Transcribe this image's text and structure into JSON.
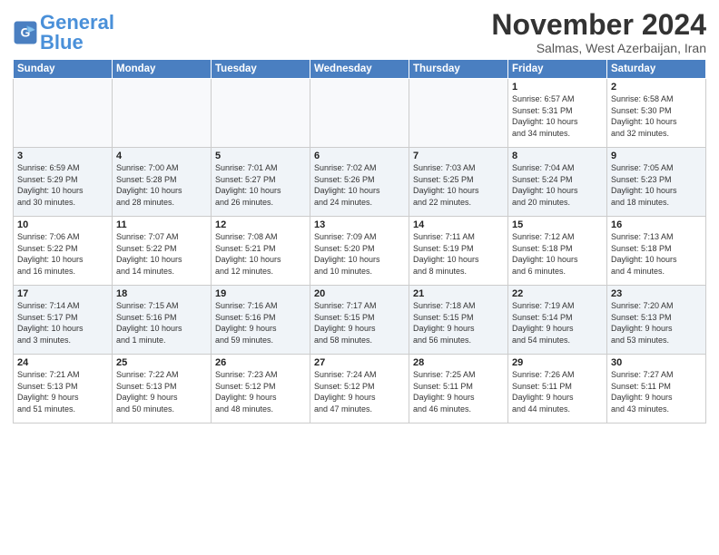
{
  "logo": {
    "text_general": "General",
    "text_blue": "Blue"
  },
  "title": "November 2024",
  "subtitle": "Salmas, West Azerbaijan, Iran",
  "weekdays": [
    "Sunday",
    "Monday",
    "Tuesday",
    "Wednesday",
    "Thursday",
    "Friday",
    "Saturday"
  ],
  "weeks": [
    [
      {
        "day": "",
        "info": ""
      },
      {
        "day": "",
        "info": ""
      },
      {
        "day": "",
        "info": ""
      },
      {
        "day": "",
        "info": ""
      },
      {
        "day": "",
        "info": ""
      },
      {
        "day": "1",
        "info": "Sunrise: 6:57 AM\nSunset: 5:31 PM\nDaylight: 10 hours\nand 34 minutes."
      },
      {
        "day": "2",
        "info": "Sunrise: 6:58 AM\nSunset: 5:30 PM\nDaylight: 10 hours\nand 32 minutes."
      }
    ],
    [
      {
        "day": "3",
        "info": "Sunrise: 6:59 AM\nSunset: 5:29 PM\nDaylight: 10 hours\nand 30 minutes."
      },
      {
        "day": "4",
        "info": "Sunrise: 7:00 AM\nSunset: 5:28 PM\nDaylight: 10 hours\nand 28 minutes."
      },
      {
        "day": "5",
        "info": "Sunrise: 7:01 AM\nSunset: 5:27 PM\nDaylight: 10 hours\nand 26 minutes."
      },
      {
        "day": "6",
        "info": "Sunrise: 7:02 AM\nSunset: 5:26 PM\nDaylight: 10 hours\nand 24 minutes."
      },
      {
        "day": "7",
        "info": "Sunrise: 7:03 AM\nSunset: 5:25 PM\nDaylight: 10 hours\nand 22 minutes."
      },
      {
        "day": "8",
        "info": "Sunrise: 7:04 AM\nSunset: 5:24 PM\nDaylight: 10 hours\nand 20 minutes."
      },
      {
        "day": "9",
        "info": "Sunrise: 7:05 AM\nSunset: 5:23 PM\nDaylight: 10 hours\nand 18 minutes."
      }
    ],
    [
      {
        "day": "10",
        "info": "Sunrise: 7:06 AM\nSunset: 5:22 PM\nDaylight: 10 hours\nand 16 minutes."
      },
      {
        "day": "11",
        "info": "Sunrise: 7:07 AM\nSunset: 5:22 PM\nDaylight: 10 hours\nand 14 minutes."
      },
      {
        "day": "12",
        "info": "Sunrise: 7:08 AM\nSunset: 5:21 PM\nDaylight: 10 hours\nand 12 minutes."
      },
      {
        "day": "13",
        "info": "Sunrise: 7:09 AM\nSunset: 5:20 PM\nDaylight: 10 hours\nand 10 minutes."
      },
      {
        "day": "14",
        "info": "Sunrise: 7:11 AM\nSunset: 5:19 PM\nDaylight: 10 hours\nand 8 minutes."
      },
      {
        "day": "15",
        "info": "Sunrise: 7:12 AM\nSunset: 5:18 PM\nDaylight: 10 hours\nand 6 minutes."
      },
      {
        "day": "16",
        "info": "Sunrise: 7:13 AM\nSunset: 5:18 PM\nDaylight: 10 hours\nand 4 minutes."
      }
    ],
    [
      {
        "day": "17",
        "info": "Sunrise: 7:14 AM\nSunset: 5:17 PM\nDaylight: 10 hours\nand 3 minutes."
      },
      {
        "day": "18",
        "info": "Sunrise: 7:15 AM\nSunset: 5:16 PM\nDaylight: 10 hours\nand 1 minute."
      },
      {
        "day": "19",
        "info": "Sunrise: 7:16 AM\nSunset: 5:16 PM\nDaylight: 9 hours\nand 59 minutes."
      },
      {
        "day": "20",
        "info": "Sunrise: 7:17 AM\nSunset: 5:15 PM\nDaylight: 9 hours\nand 58 minutes."
      },
      {
        "day": "21",
        "info": "Sunrise: 7:18 AM\nSunset: 5:15 PM\nDaylight: 9 hours\nand 56 minutes."
      },
      {
        "day": "22",
        "info": "Sunrise: 7:19 AM\nSunset: 5:14 PM\nDaylight: 9 hours\nand 54 minutes."
      },
      {
        "day": "23",
        "info": "Sunrise: 7:20 AM\nSunset: 5:13 PM\nDaylight: 9 hours\nand 53 minutes."
      }
    ],
    [
      {
        "day": "24",
        "info": "Sunrise: 7:21 AM\nSunset: 5:13 PM\nDaylight: 9 hours\nand 51 minutes."
      },
      {
        "day": "25",
        "info": "Sunrise: 7:22 AM\nSunset: 5:13 PM\nDaylight: 9 hours\nand 50 minutes."
      },
      {
        "day": "26",
        "info": "Sunrise: 7:23 AM\nSunset: 5:12 PM\nDaylight: 9 hours\nand 48 minutes."
      },
      {
        "day": "27",
        "info": "Sunrise: 7:24 AM\nSunset: 5:12 PM\nDaylight: 9 hours\nand 47 minutes."
      },
      {
        "day": "28",
        "info": "Sunrise: 7:25 AM\nSunset: 5:11 PM\nDaylight: 9 hours\nand 46 minutes."
      },
      {
        "day": "29",
        "info": "Sunrise: 7:26 AM\nSunset: 5:11 PM\nDaylight: 9 hours\nand 44 minutes."
      },
      {
        "day": "30",
        "info": "Sunrise: 7:27 AM\nSunset: 5:11 PM\nDaylight: 9 hours\nand 43 minutes."
      }
    ]
  ]
}
